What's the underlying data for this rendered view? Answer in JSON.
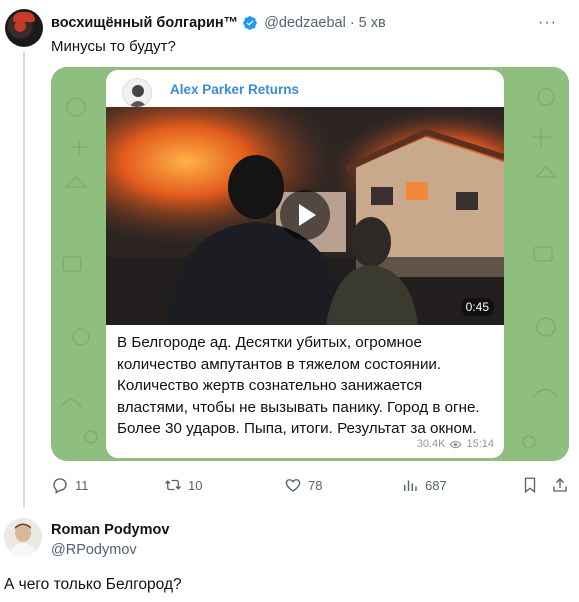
{
  "tweet": {
    "author_name": "восхищённый болгарин™",
    "handle": "@dedzaebal",
    "time": "5 хв",
    "text": "Минусы то будут?",
    "embed": {
      "channel_name": "Alex Parker Returns",
      "video_duration": "0:45",
      "text": "В Белгороде ад. Десятки убитых, огромное количество ампутантов в тяжелом состоянии. Количество жертв сознательно занижается властями, чтобы не вызывать панику. Город в огне. Более 30 ударов. Пыпа, итоги. Результат за окном.",
      "views": "30.4K",
      "time": "15:14"
    },
    "actions": {
      "replies": "11",
      "retweets": "10",
      "likes": "78",
      "views": "687"
    }
  },
  "reply": {
    "author_name": "Roman Podymov",
    "handle": "@RPodymov",
    "text": "А чего только Белгород?"
  },
  "colors": {
    "verified": "#1d9bf0",
    "channel": "#3b8bd9",
    "secondary_text": "#536471",
    "telegram_bg": "#8fbf7e"
  },
  "icons": [
    "verified-badge-icon",
    "more-icon",
    "play-icon",
    "eye-icon",
    "reply-icon",
    "retweet-icon",
    "like-icon",
    "views-icon",
    "bookmark-icon",
    "share-icon"
  ]
}
